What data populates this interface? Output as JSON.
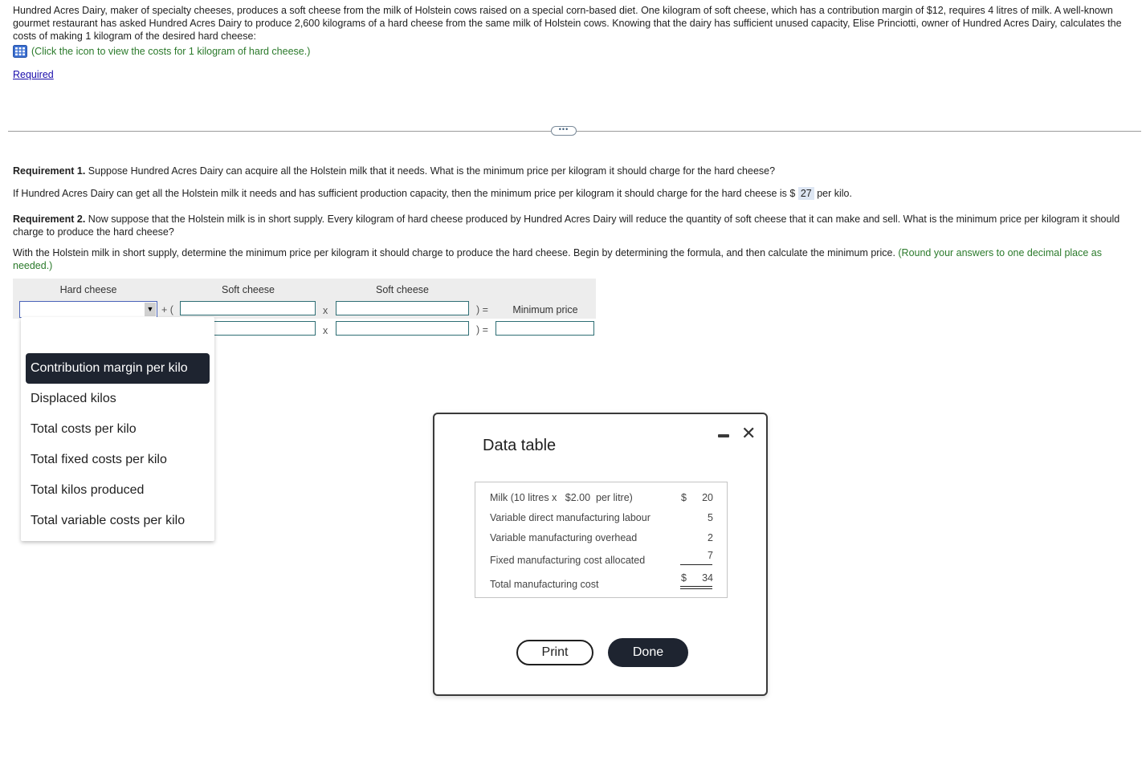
{
  "problem": {
    "intro": "Hundred Acres Dairy, maker of specialty cheeses, produces a soft cheese from the milk of Holstein cows raised on a special corn-based diet. One kilogram of soft cheese, which has a contribution margin of $12, requires 4 litres of milk. A well-known gourmet restaurant has asked Hundred Acres Dairy to produce 2,600 kilograms of a hard cheese from the same milk of Holstein cows. Knowing that the dairy has sufficient unused capacity, Elise Princiotti, owner of Hundred Acres Dairy, calculates the costs of making 1 kilogram of the desired hard cheese:",
    "icon_link_text": "(Click the icon to view the costs for 1 kilogram of hard cheese.)",
    "icon": "data-table-grid-icon",
    "required_link": "Required",
    "more_button": "•••"
  },
  "requirement1": {
    "label": "Requirement 1.",
    "question": " Suppose Hundred Acres Dairy can acquire all the Holstein milk that it needs. What is the minimum price per kilogram it should charge for the hard cheese?",
    "answer_prefix": "If Hundred Acres Dairy can get all the Holstein milk it needs and has sufficient production capacity, then the minimum price per kilogram it should charge for the hard cheese is $ ",
    "answer_value": "27",
    "answer_suffix": " per kilo."
  },
  "requirement2": {
    "label": "Requirement 2.",
    "question": " Now suppose that the Holstein milk is in short supply. Every kilogram of hard cheese produced by Hundred Acres Dairy will reduce the quantity of soft cheese that it can make and sell. What is the minimum price per kilogram it should charge to produce the hard cheese?",
    "instruction": "With the Holstein milk in short supply, determine the minimum price per kilogram it should charge to produce the hard cheese. Begin by determining the formula, and then calculate the minimum price. ",
    "round_note": "(Round your answers to one decimal place as needed.)"
  },
  "formula": {
    "headers": [
      "Hard cheese",
      "Soft cheese",
      "Soft cheese"
    ],
    "result_header": "Minimum price",
    "op_plus": "+ (",
    "op_times": "x",
    "op_equals": ") =",
    "select_value": "",
    "select_arrow": "▼",
    "inputs": {
      "row1_soft1": "",
      "row1_soft2": "",
      "row2_soft1": "",
      "row2_soft2": "",
      "row2_result": ""
    }
  },
  "dropdown": {
    "options": [
      "Contribution margin per kilo",
      "Displaced kilos",
      "Total costs per kilo",
      "Total fixed costs per kilo",
      "Total kilos produced",
      "Total variable costs per kilo"
    ],
    "highlighted": "Contribution margin per kilo"
  },
  "modal": {
    "title": "Data table",
    "minimize_icon": "minimize-icon",
    "close_icon": "✕",
    "rows": [
      {
        "label": "Milk (10 litres x   $2.00  per litre)",
        "currency": "$",
        "value": "20"
      },
      {
        "label": "Variable direct manufacturing labour",
        "currency": "",
        "value": "5"
      },
      {
        "label": "Variable manufacturing overhead",
        "currency": "",
        "value": "2"
      },
      {
        "label": "Fixed manufacturing cost allocated",
        "currency": "",
        "value": "7"
      },
      {
        "label": "Total manufacturing cost",
        "currency": "$",
        "value": "34"
      }
    ],
    "print_button": "Print",
    "done_button": "Done"
  }
}
